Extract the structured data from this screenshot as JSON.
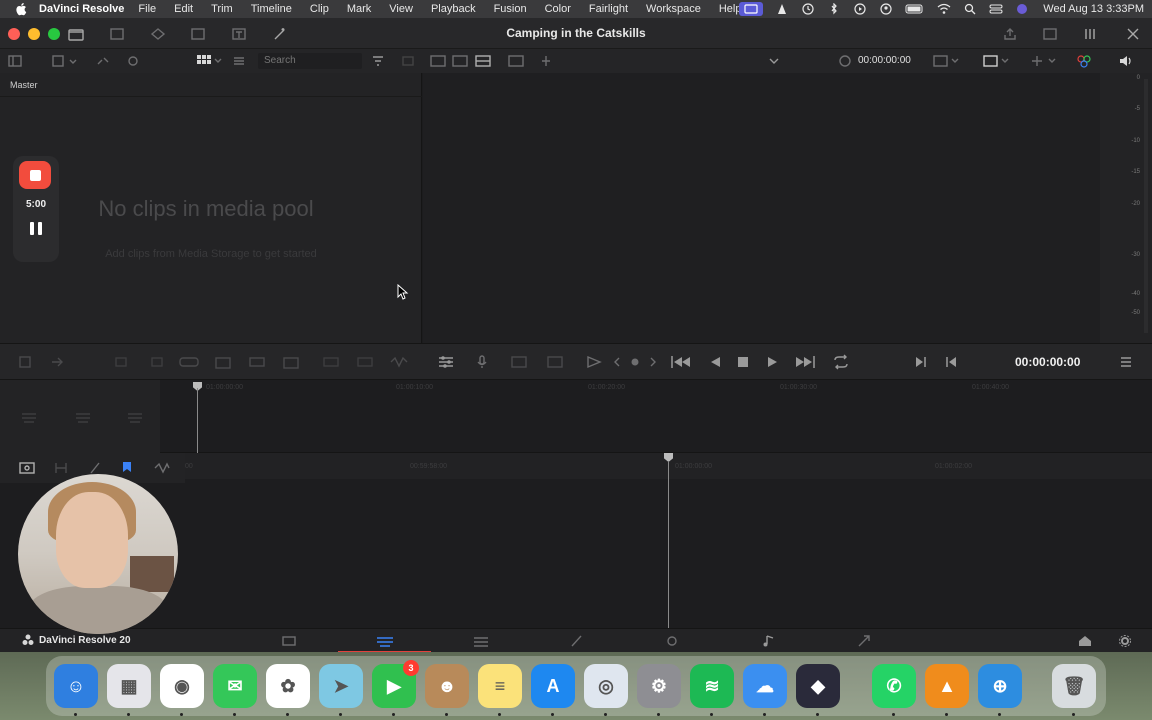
{
  "menubar": {
    "app_name": "DaVinci Resolve",
    "menus": [
      "File",
      "Edit",
      "Trim",
      "Timeline",
      "Clip",
      "Mark",
      "View",
      "Playback",
      "Fusion",
      "Color",
      "Fairlight",
      "Workspace",
      "Help"
    ],
    "clock": "Wed Aug 13  3:33PM"
  },
  "window": {
    "title": "Camping in the Catskills"
  },
  "toolbar": {
    "search_placeholder": "Search",
    "viewer_timecode": "00:00:00:00"
  },
  "media_pool": {
    "bin_label": "Master",
    "empty_title": "No clips in media pool",
    "empty_subtitle": "Add clips from Media Storage to get started"
  },
  "meter": {
    "labels": [
      "0",
      "-5",
      "-10",
      "-15",
      "-20",
      "-30",
      "-40",
      "-50"
    ]
  },
  "transport": {
    "timecode": "00:00:00:00"
  },
  "timeline": {
    "upper_ruler": [
      "01:00:00:00",
      "01:00:10:00",
      "01:00:20:00",
      "01:00:30:00",
      "01:00:40:00"
    ],
    "lower_ruler": [
      "00",
      "00:59:58:00",
      "01:00:00:00",
      "01:00:02:00"
    ]
  },
  "recorder": {
    "elapsed": "5:00"
  },
  "pagebar": {
    "brand": "DaVinci Resolve 20",
    "pages": [
      "media-page",
      "cut-page",
      "edit-page",
      "fusion-page",
      "color-page",
      "fairlight-page",
      "deliver-page"
    ],
    "active_page": "cut-page"
  },
  "dock": {
    "apps": [
      {
        "name": "finder",
        "color": "#2f7fe0",
        "glyph": "☺"
      },
      {
        "name": "launchpad",
        "color": "#e5e5ea",
        "glyph": "▦"
      },
      {
        "name": "chrome",
        "color": "#ffffff",
        "glyph": "◉"
      },
      {
        "name": "messages",
        "color": "#34c759",
        "glyph": "✉"
      },
      {
        "name": "photos",
        "color": "#ffffff",
        "glyph": "✿"
      },
      {
        "name": "maps",
        "color": "#7ec8e3",
        "glyph": "➤"
      },
      {
        "name": "facetime",
        "color": "#30c04f",
        "glyph": "▶",
        "badge": "3"
      },
      {
        "name": "contacts",
        "color": "#b88a5a",
        "glyph": "☻"
      },
      {
        "name": "notes",
        "color": "#fbe27a",
        "glyph": "≡"
      },
      {
        "name": "app-store",
        "color": "#1e88f0",
        "glyph": "A"
      },
      {
        "name": "preview",
        "color": "#dfe6ef",
        "glyph": "◎"
      },
      {
        "name": "system-settings",
        "color": "#8e8e93",
        "glyph": "⚙"
      },
      {
        "name": "spotify",
        "color": "#1db954",
        "glyph": "≋"
      },
      {
        "name": "icloud",
        "color": "#3b8ff0",
        "glyph": "☁"
      },
      {
        "name": "davinci-resolve",
        "color": "#2a2a3a",
        "glyph": "◆"
      },
      {
        "name": "whatsapp",
        "color": "#25d366",
        "glyph": "✆"
      },
      {
        "name": "vlc",
        "color": "#f08c1c",
        "glyph": "▲"
      },
      {
        "name": "safari-alt",
        "color": "#2d8de0",
        "glyph": "⊕"
      },
      {
        "name": "trash",
        "color": "#d8dcdf",
        "glyph": "🗑"
      }
    ]
  },
  "colors": {
    "accent_red": "#e2403c",
    "record_red": "#f24c3d",
    "panel_bg": "#232325"
  }
}
